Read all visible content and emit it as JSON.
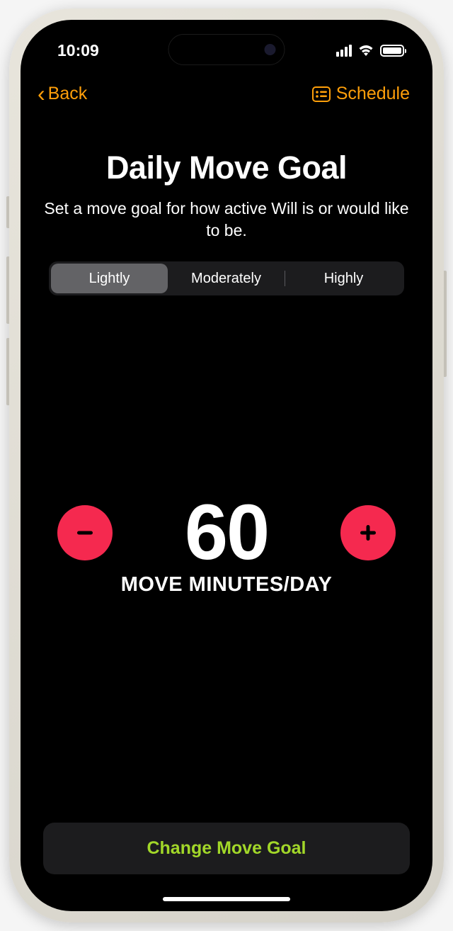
{
  "statusBar": {
    "time": "10:09"
  },
  "nav": {
    "backLabel": "Back",
    "scheduleLabel": "Schedule"
  },
  "header": {
    "title": "Daily Move Goal",
    "subtitle": "Set a move goal for how active Will is or would like to be."
  },
  "segments": {
    "options": [
      "Lightly",
      "Moderately",
      "Highly"
    ],
    "selectedIndex": 0
  },
  "goal": {
    "value": "60",
    "unit": "MOVE MINUTES/DAY"
  },
  "footer": {
    "changeButton": "Change Move Goal"
  },
  "colors": {
    "accent": "#ff9f0a",
    "stepper": "#f5294f",
    "action": "#a2d729"
  }
}
